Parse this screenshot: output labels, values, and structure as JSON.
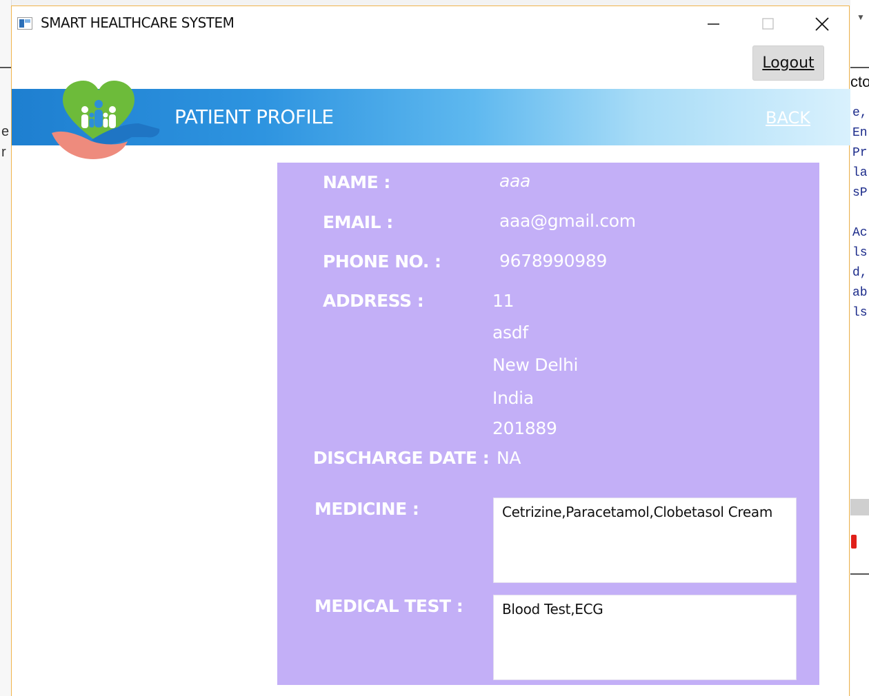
{
  "window": {
    "title": "SMART HEALTHCARE SYSTEM"
  },
  "toolbar": {
    "logout_label": "Logout"
  },
  "header": {
    "title": "PATIENT PROFILE",
    "back_label": "BACK"
  },
  "profile": {
    "name_label": "NAME :",
    "name_value": "aaa",
    "email_label": "EMAIL :",
    "email_value": "aaa@gmail.com",
    "phone_label": "PHONE NO. :",
    "phone_value": "9678990989",
    "address_label": "ADDRESS :",
    "address_lines": [
      "11",
      "asdf",
      "New Delhi",
      "India",
      "201889"
    ],
    "discharge_label": "DISCHARGE DATE :",
    "discharge_value": "NA",
    "medicine_label": "MEDICINE :",
    "medicine_value": "Cetrizine,Paracetamol,Clobetasol Cream",
    "test_label": "MEDICAL TEST :",
    "test_value": "Blood Test,ECG"
  },
  "background": {
    "right_code": [
      "e,",
      "En",
      "Pr",
      "la",
      "sP",
      "",
      "Ac",
      "ls",
      "d,",
      "ab",
      "ls"
    ],
    "right_header": "cto"
  },
  "colors": {
    "panel": "#c3aff7",
    "header_start": "#1e7fd0",
    "header_end": "#d9f1fd",
    "window_border": "#f0b34a"
  }
}
